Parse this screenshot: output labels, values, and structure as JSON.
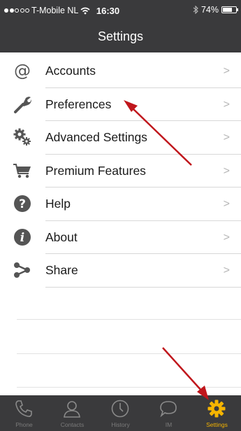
{
  "status_bar": {
    "carrier": "T-Mobile NL",
    "time": "16:30",
    "battery": "74%",
    "battery_level": 0.74
  },
  "nav": {
    "title": "Settings"
  },
  "menu": {
    "items": [
      {
        "label": "Accounts",
        "icon": "at-icon"
      },
      {
        "label": "Preferences",
        "icon": "wrench-icon"
      },
      {
        "label": "Advanced Settings",
        "icon": "gears-icon"
      },
      {
        "label": "Premium Features",
        "icon": "cart-icon"
      },
      {
        "label": "Help",
        "icon": "question-icon"
      },
      {
        "label": "About",
        "icon": "info-icon"
      },
      {
        "label": "Share",
        "icon": "share-icon"
      }
    ],
    "chevron": ">"
  },
  "tabs": [
    {
      "label": "Phone",
      "icon": "phone-icon",
      "active": false
    },
    {
      "label": "Contacts",
      "icon": "contacts-icon",
      "active": false
    },
    {
      "label": "History",
      "icon": "clock-icon",
      "active": false
    },
    {
      "label": "IM",
      "icon": "chat-bubble-icon",
      "active": false
    },
    {
      "label": "Settings",
      "icon": "gear-icon",
      "active": true
    }
  ],
  "colors": {
    "bar_background": "#3a3a3c",
    "active_tab": "#f5b400",
    "annotation_arrow": "#c0161c"
  }
}
